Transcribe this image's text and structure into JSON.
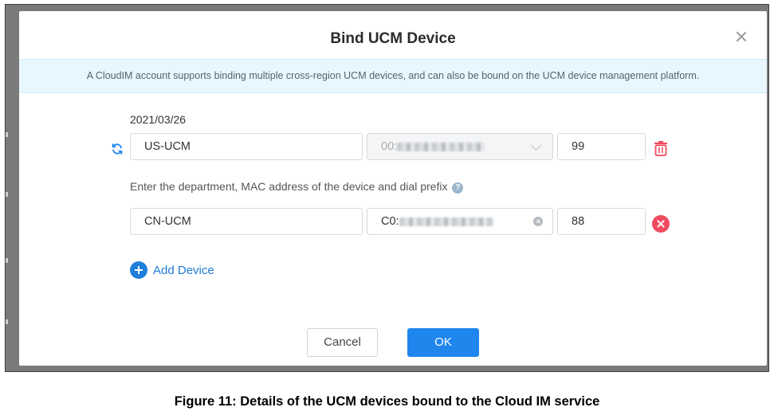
{
  "dialog": {
    "title": "Bind UCM Device",
    "notice": "A CloudIM account supports binding multiple cross-region UCM devices, and can also be bound on the UCM device management platform.",
    "date": "2021/03/26",
    "hint": "Enter the department, MAC address of the device and dial prefix",
    "rows": [
      {
        "department": "US-UCM",
        "mac": "00:",
        "prefix": "99"
      },
      {
        "department": "CN-UCM",
        "mac": "C0:",
        "prefix": "88"
      }
    ],
    "add_device_label": "Add Device",
    "cancel_label": "Cancel",
    "ok_label": "OK"
  },
  "caption": "Figure 11: Details of the UCM devices bound to the Cloud IM service",
  "colors": {
    "primary": "#1f86ee",
    "danger": "#f04b60",
    "notice_bg": "#e8f6fd"
  },
  "icons": [
    "close-icon",
    "refresh-icon",
    "chevron-down-icon",
    "trash-icon",
    "help-icon",
    "clear-icon",
    "remove-icon",
    "plus-icon"
  ]
}
